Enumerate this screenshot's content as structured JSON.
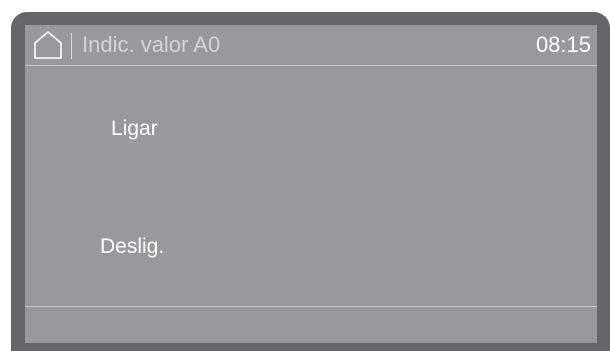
{
  "header": {
    "home_icon": "home-icon",
    "title": "Indic. valor A0",
    "clock": "08:15"
  },
  "options": {
    "on_label": "Ligar",
    "off_label": "Deslig."
  },
  "colors": {
    "bezel": "#666669",
    "screen": "#99999c",
    "text": "#ffffff",
    "title_text": "#d4d4d6"
  }
}
